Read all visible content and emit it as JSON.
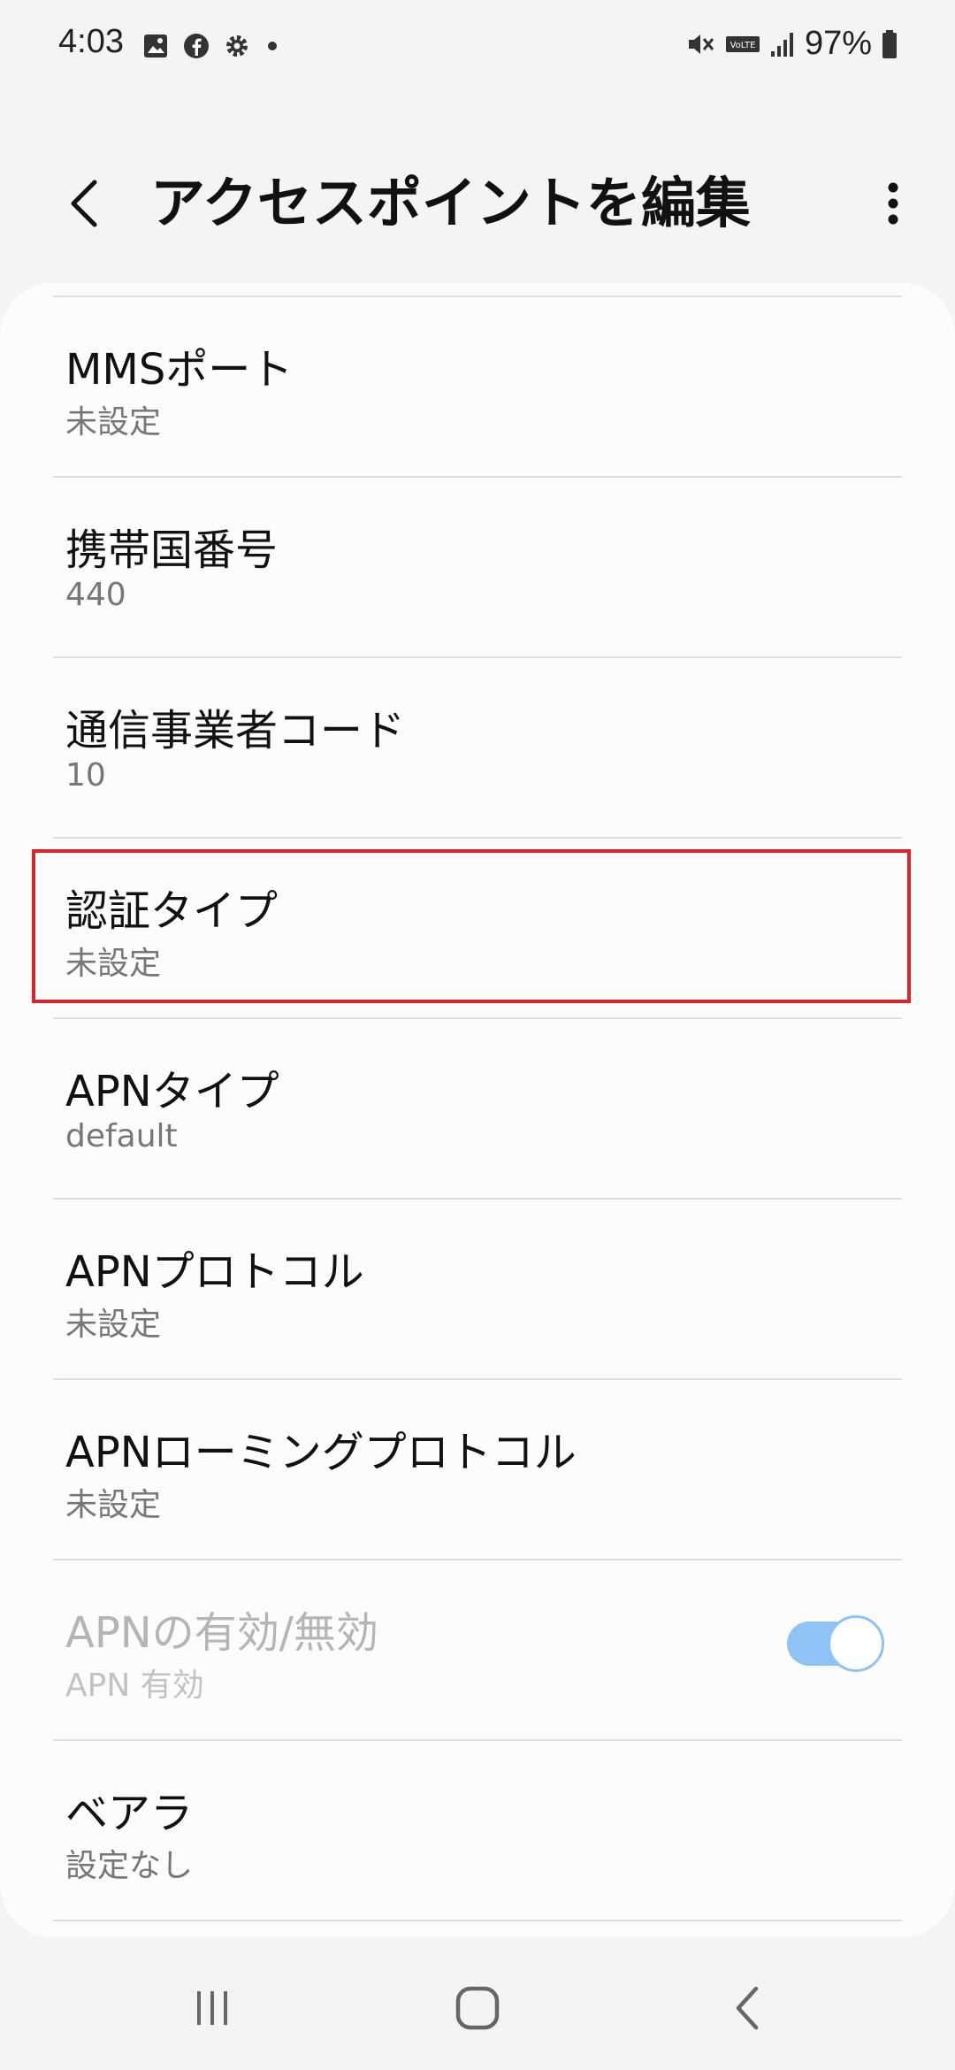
{
  "status_bar": {
    "time": "4:03",
    "battery_percent": "97%",
    "icons_left": [
      "gallery-icon",
      "facebook-icon",
      "settings-gear-icon",
      "dot-icon"
    ],
    "icons_right": [
      "mute-vibrate-icon",
      "volte-icon",
      "signal-icon",
      "battery-icon"
    ]
  },
  "header": {
    "title": "アクセスポイントを編集",
    "back_icon": "chevron-left-icon",
    "more_icon": "more-vertical-icon"
  },
  "settings": {
    "items": [
      {
        "title": "MMSポート",
        "value": "未設定"
      },
      {
        "title": "携帯国番号",
        "value": "440"
      },
      {
        "title": "通信事業者コード",
        "value": "10"
      },
      {
        "title": "認証タイプ",
        "value": "未設定",
        "highlighted": true
      },
      {
        "title": "APNタイプ",
        "value": "default"
      },
      {
        "title": "APNプロトコル",
        "value": "未設定"
      },
      {
        "title": "APNローミングプロトコル",
        "value": "未設定"
      },
      {
        "title": "APNの有効/無効",
        "value": "APN 有効",
        "disabled": true,
        "toggle_on": true
      },
      {
        "title": "ベアラ",
        "value": "設定なし"
      }
    ]
  },
  "colors": {
    "highlight_border": "#d9262d",
    "toggle_track": "#8fc3f5",
    "background": "#f4f4f4",
    "card": "#fcfcfc"
  },
  "nav_bar": {
    "icons": [
      "recent-apps-icon",
      "home-icon",
      "back-icon"
    ]
  }
}
